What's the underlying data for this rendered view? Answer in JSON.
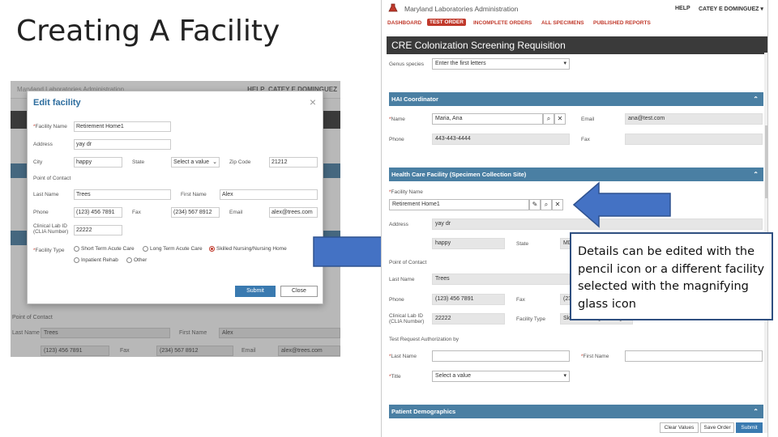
{
  "slide": {
    "title": "Creating A Facility",
    "callout": "Details can be edited with the pencil icon or a different facility selected with the magnifying glass icon"
  },
  "left_screenshot": {
    "bg_app_title": "Maryland Laboratories Administration",
    "bg_help": "HELP",
    "bg_user": "CATEY E DOMINGUEZ",
    "bg_contact_section": "Point of Contact",
    "bg_last_name_label": "Last Name",
    "bg_last_name_value": "Trees",
    "bg_first_name_label": "First Name",
    "bg_first_name_value": "Alex",
    "bg_phone_value": "(123) 456 7891",
    "bg_fax_label": "Fax",
    "bg_fax_value": "(234) 567 8912",
    "bg_email_label": "Email",
    "bg_email_value": "alex@trees.com",
    "modal": {
      "title": "Edit facility",
      "close": "×",
      "facility_name_label": "Facility Name",
      "facility_name_value": "Retirement Home1",
      "address_label": "Address",
      "address_value": "yay dr",
      "city_label": "City",
      "city_value": "happy",
      "state_label": "State",
      "state_value": "Select a value",
      "zip_label": "Zip Code",
      "zip_value": "21212",
      "contact_label": "Point of Contact",
      "last_name_label": "Last Name",
      "last_name_value": "Trees",
      "first_name_label": "First Name",
      "first_name_value": "Alex",
      "phone_label": "Phone",
      "phone_value": "(123) 456 7891",
      "fax_label": "Fax",
      "fax_value": "(234) 567 8912",
      "email_label": "Email",
      "email_value": "alex@trees.com",
      "clia_label": "Clinical Lab ID (CLIA Number)",
      "clia_value": "22222",
      "facility_type_label": "Facility Type",
      "facility_types": [
        "Short Term Acute Care",
        "Long Term Acute Care",
        "Skilled Nursing/Nursing Home",
        "Inpatient Rehab",
        "Other"
      ],
      "selected_type": "Skilled Nursing/Nursing Home",
      "submit": "Submit",
      "close_button": "Close"
    }
  },
  "right_screenshot": {
    "app_title": "Maryland Laboratories Administration",
    "help": "HELP",
    "user": "CATEY E DOMINGUEZ ▾",
    "nav": [
      "DASHBOARD",
      "TEST ORDER",
      "INCOMPLETE ORDERS",
      "ALL SPECIMENS",
      "PUBLISHED REPORTS"
    ],
    "active_nav": "TEST ORDER",
    "page_title": "CRE Colonization Screening Requisition",
    "genus_label": "Genus species",
    "genus_placeholder": "Enter the first letters",
    "hai_section": "HAI Coordinator",
    "hai_name_label": "Name",
    "hai_name_value": "Maria, Ana",
    "hai_email_label": "Email",
    "hai_email_value": "ana@test.com",
    "hai_phone_label": "Phone",
    "hai_phone_value": "443-443-4444",
    "hai_fax_label": "Fax",
    "hcf_section": "Health Care Facility (Specimen Collection Site)",
    "facility_name_label": "Facility Name",
    "facility_name_value": "Retirement Home1",
    "address_label": "Address",
    "address_value": "yay dr",
    "city_value": "happy",
    "state_label": "State",
    "state_value": "MD",
    "contact_label": "Point of Contact",
    "last_name_label": "Last Name",
    "last_name_value": "Trees",
    "phone_label": "Phone",
    "phone_value": "(123) 456 7891",
    "fax_label": "Fax",
    "fax_value": "(234) 567 8912",
    "clia_label": "Clinical Lab ID (CLIA Number)",
    "clia_value": "22222",
    "facility_type_label": "Facility Type",
    "facility_type_value": "Skilled Nursing/Nursing Home",
    "auth_label": "Test Request Authorization by",
    "auth_last_label": "Last Name",
    "auth_first_label": "First Name",
    "title_label": "Title",
    "title_placeholder": "Select a value",
    "patient_section": "Patient Demographics",
    "clear_values": "Clear Values",
    "save_order": "Save Order",
    "submit": "Submit"
  }
}
